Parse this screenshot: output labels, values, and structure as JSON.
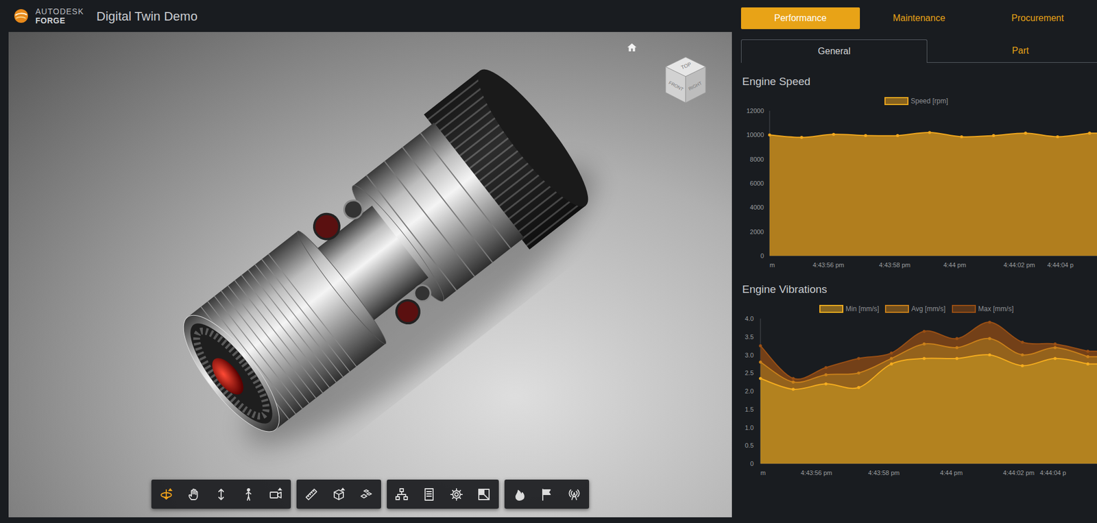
{
  "header": {
    "brand": "AUTODESK",
    "product": "FORGE",
    "title": "Digital Twin Demo"
  },
  "viewer": {
    "viewcube": {
      "top": "TOP",
      "front": "FRONT",
      "right": "RIGHT"
    },
    "toolbar": [
      [
        {
          "selected": true
        },
        {
          "selected": false
        },
        {
          "selected": false
        },
        {
          "selected": false
        },
        {
          "selected": false
        }
      ],
      [
        {
          "selected": false
        },
        {
          "selected": false
        },
        {
          "selected": false
        }
      ],
      [
        {
          "selected": false
        },
        {
          "selected": false
        },
        {
          "selected": false
        },
        {
          "selected": false
        }
      ],
      [
        {
          "selected": false
        },
        {
          "selected": false
        },
        {
          "selected": false
        }
      ]
    ]
  },
  "tabs": [
    {
      "label": "Performance",
      "selected": true
    },
    {
      "label": "Maintenance",
      "selected": false
    },
    {
      "label": "Procurement",
      "selected": false
    }
  ],
  "subtabs": [
    {
      "label": "General",
      "selected": true
    },
    {
      "label": "Part",
      "selected": false
    }
  ],
  "charts": [
    {
      "title": "Engine Speed",
      "y_ticks": [
        "12000",
        "10000",
        "8000",
        "6000",
        "4000",
        "2000",
        "0"
      ],
      "x_ticks": [
        "m",
        "4:43:56 pm",
        "4:43:58 pm",
        "4:44 pm",
        "4:44:02 pm",
        "4:44:04 p"
      ],
      "series": [
        {
          "name": "Speed [rpm]",
          "color": "#f2a81d",
          "values": [
            10000,
            9800,
            10050,
            9950,
            9950,
            10200,
            9850,
            9950,
            10150,
            9850,
            10150
          ]
        }
      ]
    },
    {
      "title": "Engine Vibrations",
      "y_ticks": [
        "4.0",
        "3.5",
        "3.0",
        "2.5",
        "2.0",
        "1.5",
        "1.0",
        "0.5",
        "0"
      ],
      "x_ticks": [
        "m",
        "4:43:56 pm",
        "4:43:58 pm",
        "4:44 pm",
        "4:44:02 pm",
        "4:44:04 p"
      ],
      "series": [
        {
          "name": "Min [mm/s]",
          "color": "#f5ad1f",
          "values": [
            2.35,
            2.05,
            2.2,
            2.1,
            2.75,
            2.9,
            2.9,
            3.0,
            2.7,
            2.9,
            2.75
          ]
        },
        {
          "name": "Avg [mm/s]",
          "color": "#c9801a",
          "values": [
            2.8,
            2.25,
            2.45,
            2.5,
            2.9,
            3.3,
            3.2,
            3.45,
            3.0,
            3.2,
            2.95
          ]
        },
        {
          "name": "Max [mm/s]",
          "color": "#9a4f14",
          "values": [
            3.25,
            2.35,
            2.65,
            2.9,
            3.05,
            3.65,
            3.45,
            3.9,
            3.35,
            3.3,
            3.1
          ]
        }
      ]
    }
  ]
}
